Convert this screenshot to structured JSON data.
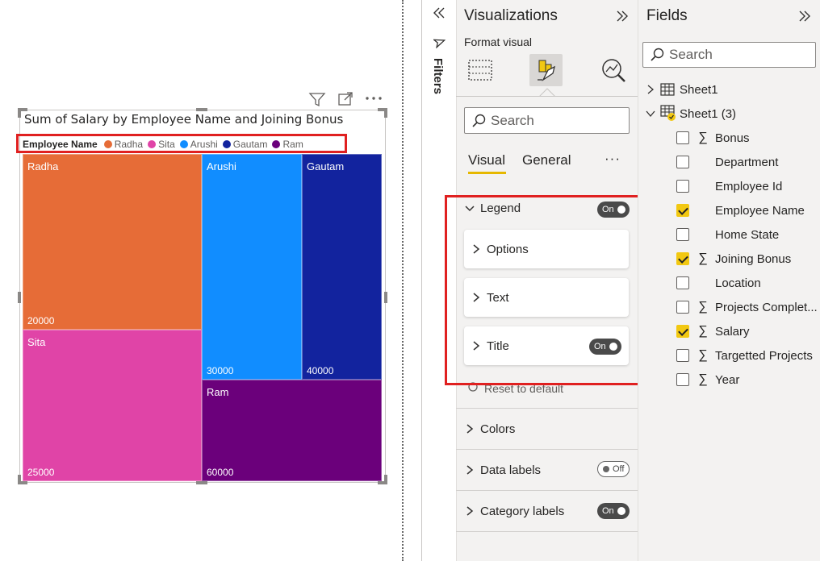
{
  "visual": {
    "title": "Sum of Salary by Employee Name and Joining Bonus",
    "legend": {
      "title": "Employee Name",
      "items": [
        {
          "label": "Radha",
          "color": "#e66c37"
        },
        {
          "label": "Sita",
          "color": "#e044a7"
        },
        {
          "label": "Arushi",
          "color": "#118dff"
        },
        {
          "label": "Gautam",
          "color": "#12239e"
        },
        {
          "label": "Ram",
          "color": "#6b007b"
        }
      ]
    },
    "tiles": [
      {
        "name": "Radha",
        "value": "20000",
        "color": "#e66c37"
      },
      {
        "name": "Sita",
        "value": "25000",
        "color": "#e044a7"
      },
      {
        "name": "Arushi",
        "value": "30000",
        "color": "#118dff"
      },
      {
        "name": "Gautam",
        "value": "40000",
        "color": "#12239e"
      },
      {
        "name": "Ram",
        "value": "60000",
        "color": "#6b007b"
      }
    ],
    "header_icons": [
      "filter-icon",
      "focus-mode-icon",
      "more-options-icon"
    ]
  },
  "filters": {
    "label": "Filters"
  },
  "visualizations": {
    "title": "Visualizations",
    "subtitle": "Format visual",
    "search_placeholder": "Search",
    "tabs": {
      "visual": "Visual",
      "general": "General",
      "more": "···"
    },
    "legend_section": {
      "label": "Legend",
      "toggle": "On",
      "cards": [
        {
          "label": "Options"
        },
        {
          "label": "Text"
        },
        {
          "label": "Title",
          "toggle": "On"
        }
      ]
    },
    "reset_label": "Reset to default",
    "sections": [
      {
        "label": "Colors"
      },
      {
        "label": "Data labels",
        "toggle": "Off"
      },
      {
        "label": "Category labels",
        "toggle": "On"
      }
    ]
  },
  "fields": {
    "title": "Fields",
    "search_placeholder": "Search",
    "tables": [
      {
        "label": "Sheet1"
      },
      {
        "label": "Sheet1 (3)"
      }
    ],
    "items": [
      {
        "label": "Bonus",
        "sigma": true,
        "checked": false
      },
      {
        "label": "Department",
        "sigma": false,
        "checked": false
      },
      {
        "label": "Employee Id",
        "sigma": false,
        "checked": false
      },
      {
        "label": "Employee Name",
        "sigma": false,
        "checked": true
      },
      {
        "label": "Home State",
        "sigma": false,
        "checked": false
      },
      {
        "label": "Joining Bonus",
        "sigma": true,
        "checked": true
      },
      {
        "label": "Location",
        "sigma": false,
        "checked": false
      },
      {
        "label": "Projects Complet...",
        "sigma": true,
        "checked": false
      },
      {
        "label": "Salary",
        "sigma": true,
        "checked": true
      },
      {
        "label": "Targetted Projects",
        "sigma": true,
        "checked": false
      },
      {
        "label": "Year",
        "sigma": true,
        "checked": false
      }
    ]
  },
  "colors": {
    "highlight": "#e02020",
    "accent": "#e6b800"
  }
}
